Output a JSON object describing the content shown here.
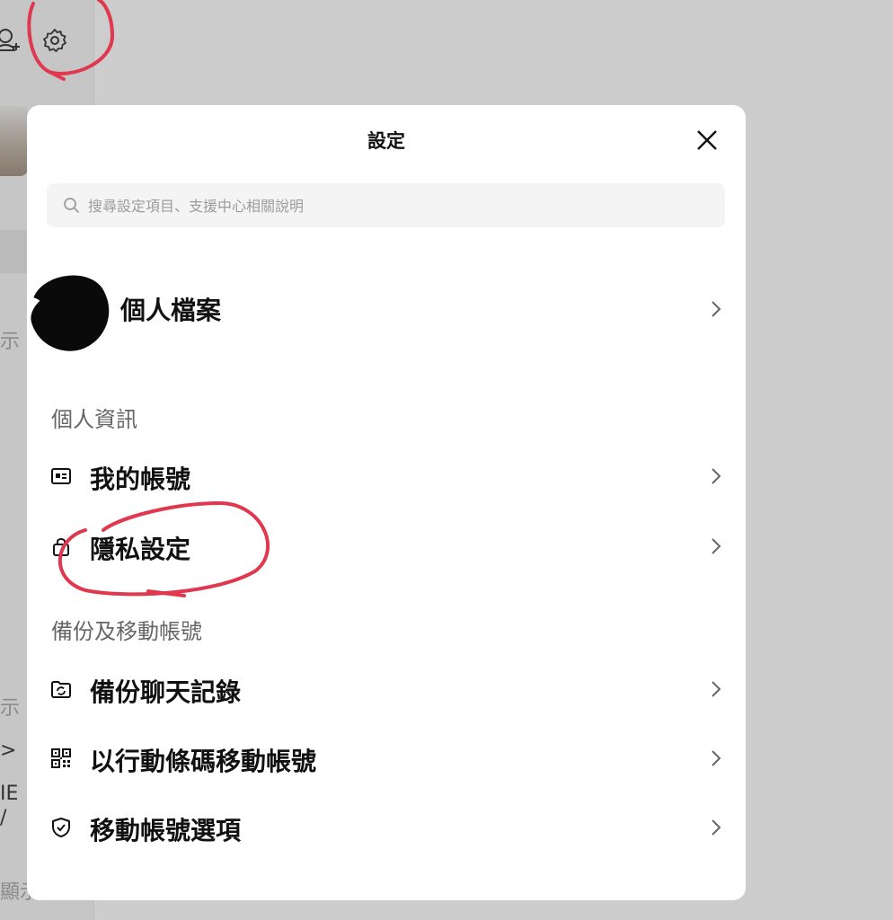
{
  "background": {
    "side_texts": [
      "示",
      "示",
      ">",
      "IE",
      "/",
      "顯示"
    ]
  },
  "modal": {
    "title": "設定",
    "search": {
      "placeholder": "搜尋設定項目、支援中心相關說明",
      "value": ""
    },
    "profile": {
      "label": "個人檔案"
    },
    "sections": [
      {
        "title": "個人資訊",
        "items": [
          {
            "label": "我的帳號",
            "icon": "id-card-icon"
          },
          {
            "label": "隱私設定",
            "icon": "lock-icon"
          }
        ]
      },
      {
        "title": "備份及移動帳號",
        "items": [
          {
            "label": "備份聊天記錄",
            "icon": "folder-sync-icon"
          },
          {
            "label": "以行動條碼移動帳號",
            "icon": "qr-code-icon"
          },
          {
            "label": "移動帳號選項",
            "icon": "shield-check-icon"
          }
        ]
      }
    ]
  },
  "colors": {
    "annotation": "#e0394f",
    "overlay": "#cdcdcd",
    "modal_bg": "#ffffff"
  }
}
